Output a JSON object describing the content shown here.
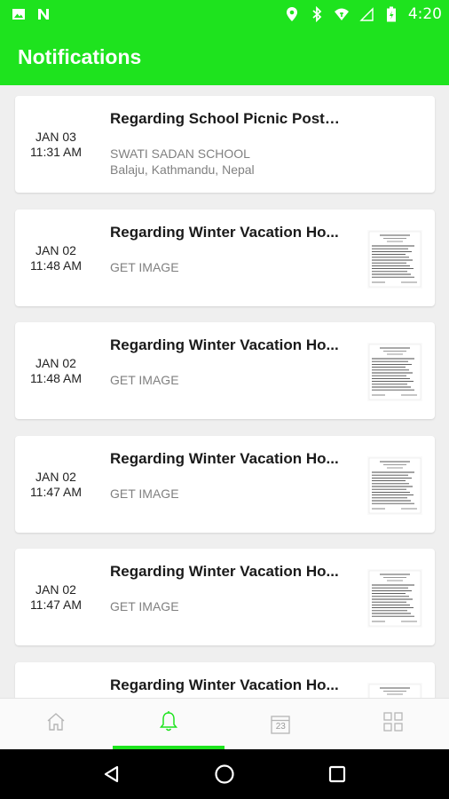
{
  "status_bar": {
    "time": "4:20",
    "left_icons": [
      "image-icon",
      "n-logo-icon"
    ],
    "right_icons": [
      "location-icon",
      "bluetooth-icon",
      "wifi-icon",
      "signal-icon",
      "battery-icon"
    ]
  },
  "app_bar": {
    "title": "Notifications"
  },
  "notifications": [
    {
      "date": "JAN 03",
      "time": "11:31 AM",
      "title": "Regarding School Picnic Postp...",
      "line1": "SWATI SADAN SCHOOL",
      "line2": "Balaju, Kathmandu, Nepal",
      "has_image": false
    },
    {
      "date": "JAN 02",
      "time": "11:48 AM",
      "title": "Regarding Winter Vacation Ho...",
      "line1": "GET IMAGE",
      "line2": "",
      "has_image": true
    },
    {
      "date": "JAN 02",
      "time": "11:48 AM",
      "title": "Regarding Winter Vacation Ho...",
      "line1": "GET IMAGE",
      "line2": "",
      "has_image": true
    },
    {
      "date": "JAN 02",
      "time": "11:47 AM",
      "title": "Regarding Winter Vacation Ho...",
      "line1": "GET IMAGE",
      "line2": "",
      "has_image": true
    },
    {
      "date": "JAN 02",
      "time": "11:47 AM",
      "title": "Regarding Winter Vacation Ho...",
      "line1": "GET IMAGE",
      "line2": "",
      "has_image": true
    },
    {
      "date": "",
      "time": "",
      "title": "Regarding Winter Vacation Ho...",
      "line1": "",
      "line2": "",
      "has_image": true
    }
  ],
  "bottom_nav": {
    "items": [
      {
        "icon": "home-icon",
        "active": false
      },
      {
        "icon": "bell-icon",
        "active": true
      },
      {
        "icon": "calendar-icon",
        "label": "23",
        "active": false
      },
      {
        "icon": "grid-icon",
        "active": false
      }
    ]
  },
  "colors": {
    "primary": "#1ee31e",
    "background": "#efefef",
    "title_text": "#1a1a1a",
    "subtext": "#808080"
  }
}
